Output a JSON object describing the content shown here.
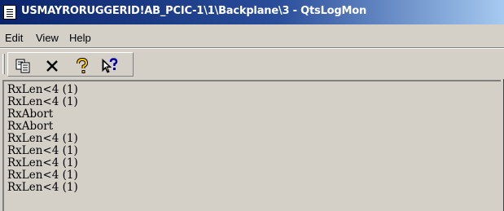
{
  "window": {
    "title": "USMAYRORUGGERID!AB_PCIC-1\\1\\Backplane\\3 - QtsLogMon"
  },
  "menu": {
    "items": [
      "Edit",
      "View",
      "Help"
    ]
  },
  "toolbar": {
    "buttons": [
      {
        "icon": "copy-icon"
      },
      {
        "icon": "delete-x-icon"
      },
      {
        "icon": "help-question-icon"
      },
      {
        "icon": "context-help-pointer-icon"
      }
    ]
  },
  "log": {
    "lines": [
      "RxLen<4 (1)",
      "RxLen<4 (1)",
      "RxAbort",
      "RxAbort",
      "RxLen<4 (1)",
      "RxLen<4 (1)",
      "RxLen<4 (1)",
      "RxLen<4 (1)",
      "RxLen<4 (1)"
    ]
  },
  "colors": {
    "titlebar_start": "#0a246a",
    "titlebar_end": "#a6caf0",
    "face": "#d4d0c8",
    "help_yellow": "#ffcc00"
  }
}
